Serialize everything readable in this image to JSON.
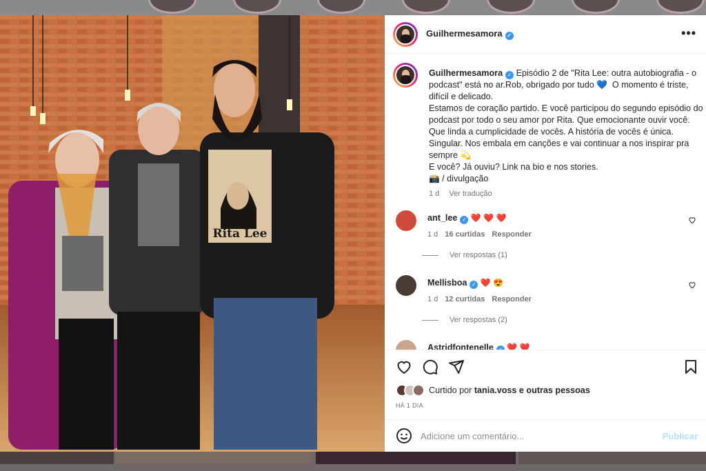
{
  "post": {
    "author": "Guilhermesamora",
    "more_icon": "more-horizontal-icon"
  },
  "caption": {
    "username": "Guilhermesamora",
    "text": " Episódio 2 de \"Rita Lee: outra autobiografia - o podcast\" está no ar.Rob, obrigado por tudo 💙  O momento é triste, difícil e delicado.\nEstamos de coração partido. E você participou do segundo episódio do podcast por todo o seu amor por Rita. Que emocionante ouvir você. Que linda a cumplicidade de vocês. A história de vocês é única. Singular. Nos embala em canções e vai continuar a nos inspirar pra sempre 💫\nE você? Já ouviu? Link na bio e nos stories.\n📸 / divulgação",
    "time": "1 d",
    "translate": "Ver tradução"
  },
  "comments": [
    {
      "username": "ant_lee",
      "text": "❤️ ❤️ ❤️",
      "time": "1 d",
      "likes": "16 curtidas",
      "reply": "Responder",
      "replies": "Ver respostas (1)"
    },
    {
      "username": "Mellisboa",
      "text": "❤️ 😍",
      "time": "1 d",
      "likes": "12 curtidas",
      "reply": "Responder",
      "replies": "Ver respostas (2)"
    },
    {
      "username": "Astridfontenelle",
      "text": "❤️ ❤️"
    }
  ],
  "likes": {
    "prefix": "Curtido por ",
    "user": "tania.voss",
    "suffix": " e outras pessoas"
  },
  "when": "HÁ 1 DIA",
  "add_comment": {
    "placeholder": "Adicione um comentário...",
    "publish": "Publicar"
  },
  "photo": {
    "shirt_text": "Rita Lee"
  },
  "colors": {
    "verified": "#3897f0",
    "heart": "#ed4956",
    "publish_disabled": "#b2dffc"
  }
}
